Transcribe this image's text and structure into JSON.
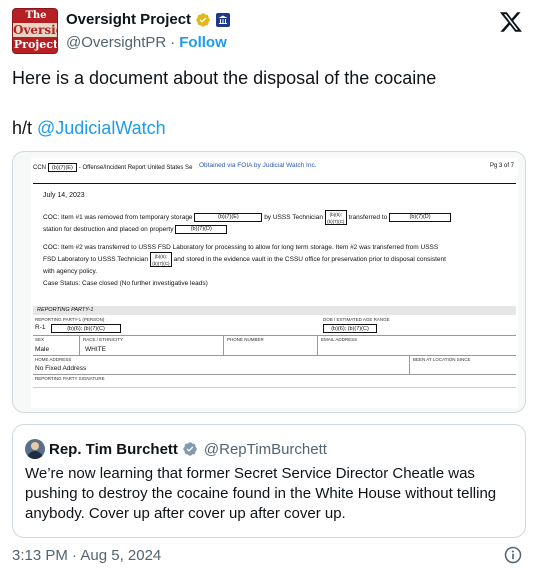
{
  "author": {
    "display_name": "Oversight Project",
    "handle": "@OversightPR",
    "separator": "·",
    "follow_label": "Follow",
    "avatar_lines": [
      "The",
      "Oversight",
      "Project"
    ]
  },
  "tweet": {
    "line1": "Here is a document about the disposal of the cocaine",
    "line2_prefix": "h/t ",
    "line2_mention": "@JudicialWatch"
  },
  "document": {
    "ccn_label": "CCN",
    "ccn_redaction": "(b)(7)(E)",
    "header_title": "- Offense/Incident Report United States Se",
    "watermark": "Obtained via FOIA by Judicial Watch Inc.",
    "page": "Pg 3 of 7",
    "date": "July 14, 2023",
    "coc1_a": "COC: Item #1 was removed from temporary storage",
    "redact_7e": "(b)(7)(E)",
    "coc1_b": "by USSS Technician",
    "redact_6_7c_a": "(b)(6);",
    "redact_6_7c_b": "(b)(7)(C)",
    "coc1_c": "transferred to",
    "redact_7d": "(b)(7)(D)",
    "coc1_d": "station for destruction and placed on property",
    "redact_7d_2": "(b)(7)(D)",
    "coc2_a": "COC: Item #2 was transferred to USSS FSD Laboratory for processing to allow for long term storage. Item #2 was transferred from USSS",
    "coc2_b": "FSD Laboratory to USSS Technician",
    "coc2_c": "and stored in the evidence vault in the CSSU office for preservation prior to disposal consistent",
    "coc2_d": "with agency policy.",
    "case_status": "Case Status: Case closed (No further investigative leads)",
    "section_title": "REPORTING PARTY-1",
    "lbl_reporting_party": "Reporting Party-1 (Person)",
    "lbl_dob": "DOB / Estimated Age Range",
    "rp_id": "R-1",
    "redact_person": "(b)(6); (b)(7)(C)",
    "redact_dob": "(b)(6); (b)(7)(C)",
    "lbl_sex": "Sex",
    "lbl_race": "Race / Ethnicity",
    "lbl_phone": "Phone Number",
    "lbl_email": "Email Address",
    "sex": "Male",
    "race": "WHITE",
    "lbl_home": "Home Address",
    "lbl_been_at": "Been at Location Since",
    "home_address": "No Fixed Address",
    "lbl_signature": "Reporting Party Signature"
  },
  "quoted": {
    "name": "Rep. Tim Burchett",
    "handle": "@RepTimBurchett",
    "text": "We’re now learning that former Secret Service Director Cheatle was pushing to destroy the cocaine found in the White House without telling anybody. Cover up after cover up after cover up."
  },
  "meta": {
    "timestamp": "3:13 PM · Aug 5, 2024"
  },
  "colors": {
    "accent": "#1d9bf0",
    "verified_gold": "#e2b719",
    "gov_badge": "#1d3a8a",
    "avatar_red": "#b52025"
  },
  "icons": [
    "verified-gold-icon",
    "government-badge-icon",
    "x-logo-icon",
    "verified-badge-icon",
    "info-icon"
  ]
}
